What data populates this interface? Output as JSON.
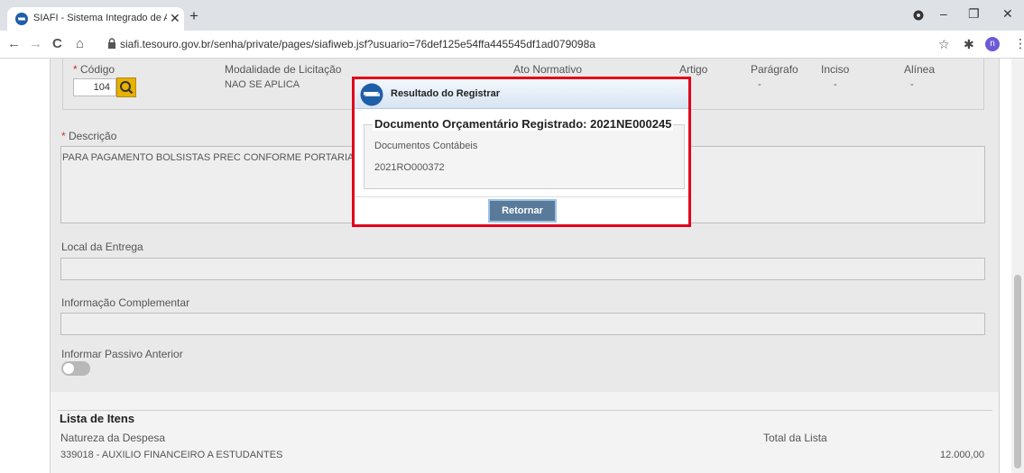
{
  "browser": {
    "tab_title": "SIAFI - Sistema Integrado de Adm",
    "tab_close": "✕",
    "new_tab": "+",
    "url": "siafi.tesouro.gov.br/senha/private/pages/siafiweb.jsf?usuario=76def125e54ffa445545df1ad079098a",
    "profile_initial": "n",
    "window": {
      "minimize": "–",
      "restore": "❐",
      "close": "✕"
    },
    "nav": {
      "back": "←",
      "forward": "→",
      "reload": "C",
      "home": "⌂"
    },
    "icons": {
      "star": "☆",
      "extension": "✱",
      "menu": "⋮"
    }
  },
  "form": {
    "codigo": {
      "label": "Código",
      "value": "104"
    },
    "modalidade": {
      "label": "Modalidade de Licitação",
      "value": "NAO SE APLICA"
    },
    "ato_normativo": {
      "label": "Ato Normativo"
    },
    "artigo": {
      "label": "Artigo"
    },
    "paragrafo": {
      "label": "Parágrafo",
      "value": "-"
    },
    "inciso": {
      "label": "Inciso",
      "value": "-"
    },
    "alinea": {
      "label": "Alínea",
      "value": "-"
    },
    "descricao": {
      "label": "Descrição",
      "value": "PARA PAGAMENTO BOLSISTAS PREC CONFORME PORTARIA 4"
    },
    "local_entrega": {
      "label": "Local da Entrega",
      "value": ""
    },
    "info_complementar": {
      "label": "Informação Complementar",
      "value": ""
    },
    "passivo_anterior": {
      "label": "Informar Passivo Anterior",
      "enabled": false
    },
    "required_mark": "*"
  },
  "items": {
    "title": "Lista de Itens",
    "col_natureza": "Natureza da Despesa",
    "col_total": "Total da Lista",
    "rows": [
      {
        "natureza": "339018 - AUXILIO FINANCEIRO A ESTUDANTES",
        "total": "12.000,00"
      }
    ]
  },
  "modal": {
    "title": "Resultado do Registrar",
    "legend": "Documento Orçamentário Registrado: 2021NE000245",
    "line1": "Documentos Contábeis",
    "line2": "2021RO000372",
    "button": "Retornar",
    "highlight_color": "#e1001a"
  },
  "colors": {
    "search_button": "#e7b100",
    "return_button": "#5a7a99"
  }
}
